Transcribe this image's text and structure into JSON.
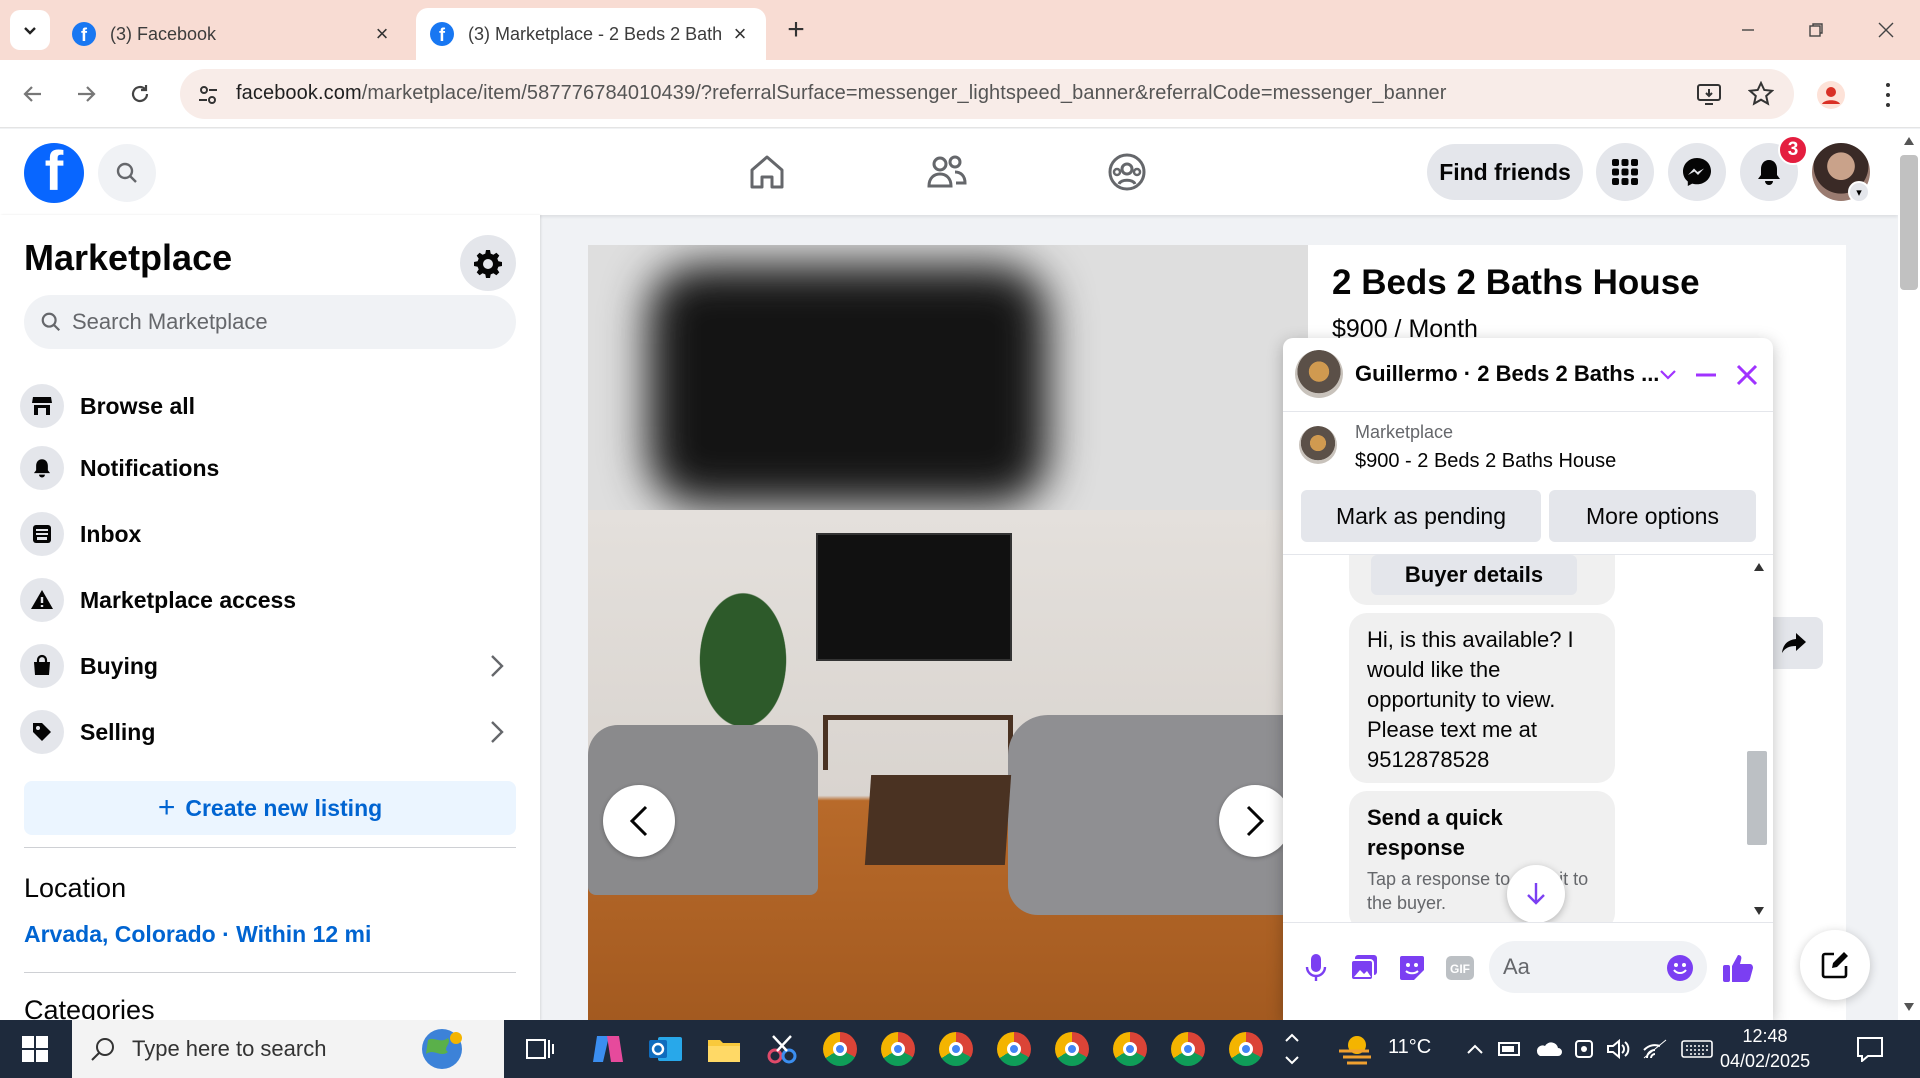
{
  "browser": {
    "tabs": [
      {
        "title": "(3) Facebook",
        "active": false
      },
      {
        "title": "(3) Marketplace - 2 Beds 2 Bath",
        "active": true
      }
    ],
    "url_domain": "facebook.com",
    "url_path": "/marketplace/item/587776784010439/?referralSurface=messenger_lightspeed_banner&referralCode=messenger_banner"
  },
  "header": {
    "find_friends": "Find friends",
    "notifications_count": "3",
    "icons": [
      "facebook-logo",
      "search-icon",
      "home-icon",
      "friends-icon",
      "groups-icon",
      "menu-grid-icon",
      "messenger-icon",
      "bell-icon"
    ]
  },
  "sidebar": {
    "title": "Marketplace",
    "search_placeholder": "Search Marketplace",
    "items": [
      {
        "label": "Browse all",
        "icon": "storefront-icon"
      },
      {
        "label": "Notifications",
        "icon": "bell-icon"
      },
      {
        "label": "Inbox",
        "icon": "inbox-icon"
      },
      {
        "label": "Marketplace access",
        "icon": "warning-icon"
      },
      {
        "label": "Buying",
        "icon": "bag-icon"
      },
      {
        "label": "Selling",
        "icon": "tag-icon"
      }
    ],
    "create_listing": "Create new listing",
    "location_title": "Location",
    "location_value": "Arvada, Colorado · Within 12 mi",
    "categories_title": "Categories"
  },
  "listing": {
    "title": "2 Beds 2 Baths House",
    "price": "$900 / Month"
  },
  "chat": {
    "name": "Guillermo · 2 Beds 2 Baths ...",
    "item_source": "Marketplace",
    "item_title": "$900 - 2 Beds 2 Baths House",
    "mark_pending": "Mark as pending",
    "more_options": "More options",
    "buyer_details": "Buyer details",
    "message": "Hi, is this available? I would like the opportunity to view. Please text me at 9512878528",
    "quick_title": "Send a quick response",
    "quick_sub": "Tap a response to send it to the buyer.",
    "input_placeholder": "Aa",
    "accent": "#a033ff"
  },
  "taskbar": {
    "search_placeholder": "Type here to search",
    "temperature": "11°C",
    "time": "12:48",
    "date": "04/02/2025"
  },
  "colors": {
    "facebook_blue": "#0866ff",
    "link_blue": "#0064d1",
    "tabstrip": "#f8dcd3",
    "badge_red": "#e41e3f"
  }
}
